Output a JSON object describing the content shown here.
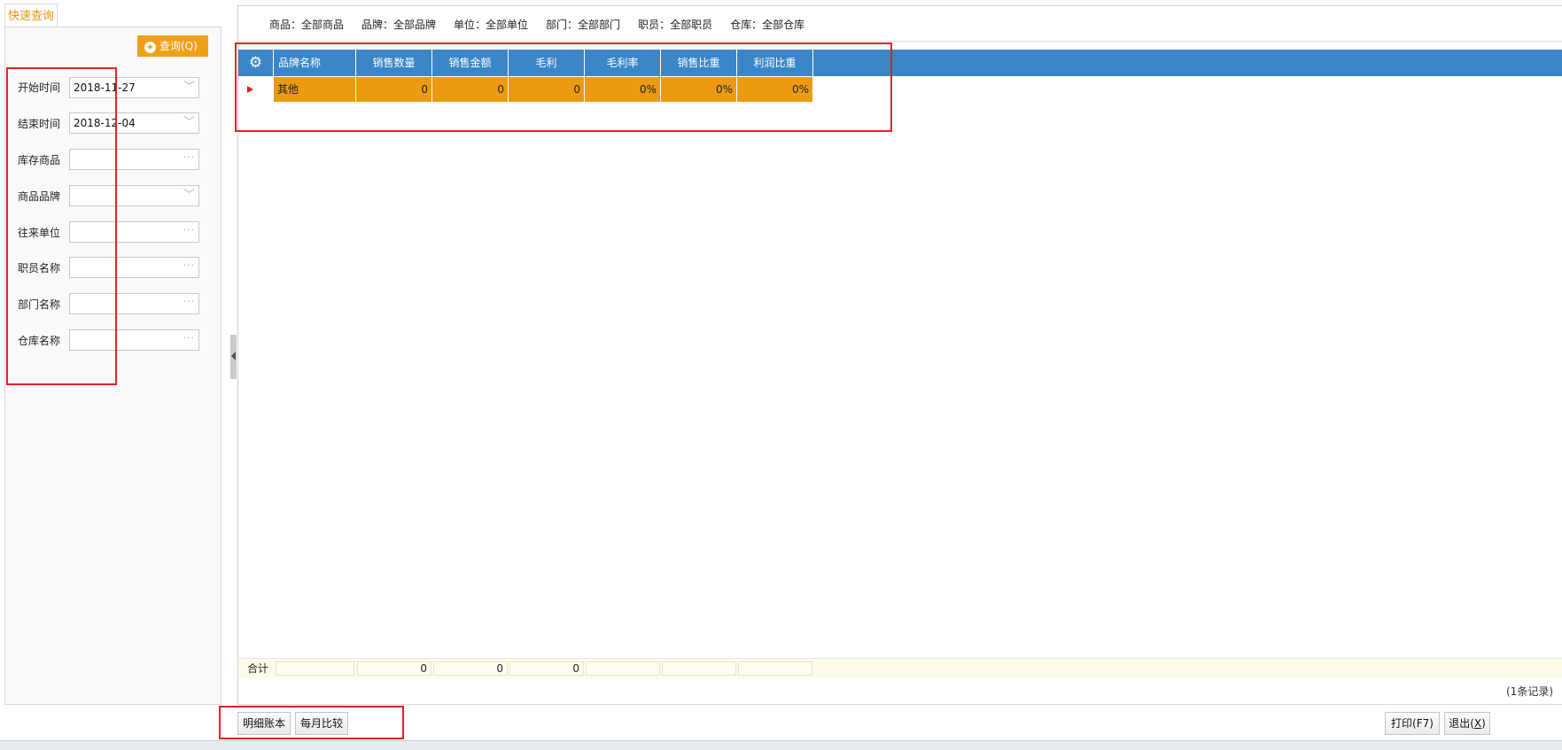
{
  "left_panel": {
    "tab_label": "快速查询",
    "query_button": "查询(Q)",
    "fields": [
      {
        "label": "开始时间",
        "value": "2018-11-27",
        "kind": "dropdown"
      },
      {
        "label": "结束时间",
        "value": "2018-12-04",
        "kind": "dropdown"
      },
      {
        "label": "库存商品",
        "value": "",
        "kind": "ellipsis"
      },
      {
        "label": "商品品牌",
        "value": "",
        "kind": "dropdown"
      },
      {
        "label": "往来单位",
        "value": "",
        "kind": "ellipsis"
      },
      {
        "label": "职员名称",
        "value": "",
        "kind": "ellipsis"
      },
      {
        "label": "部门名称",
        "value": "",
        "kind": "ellipsis"
      },
      {
        "label": "仓库名称",
        "value": "",
        "kind": "ellipsis"
      }
    ]
  },
  "filter_bar": [
    "商品：全部商品",
    "品牌：全部品牌",
    "单位：全部单位",
    "部门：全部部门",
    "职员：全部职员",
    "仓库：全部仓库"
  ],
  "grid": {
    "columns": [
      "品牌名称",
      "销售数量",
      "销售金额",
      "毛利",
      "毛利率",
      "销售比重",
      "利润比重"
    ],
    "rows": [
      [
        "其他",
        "0",
        "0",
        "0",
        "0%",
        "0%",
        "0%"
      ]
    ],
    "totals_label": "合计",
    "totals": [
      "",
      "0",
      "0",
      "0",
      "",
      "",
      ""
    ],
    "record_count": "(1条记录)"
  },
  "buttons": {
    "detail_ledger": "明细账本",
    "monthly_compare": "每月比较",
    "print_text": "打印(F7)",
    "exit_prefix": "退出(",
    "exit_key": "X",
    "exit_suffix": ")"
  },
  "colors": {
    "accent_orange": "#f0a018",
    "grid_header_blue": "#3a86c8",
    "selected_row": "#ec9a12",
    "annotation_red": "#e52025"
  }
}
